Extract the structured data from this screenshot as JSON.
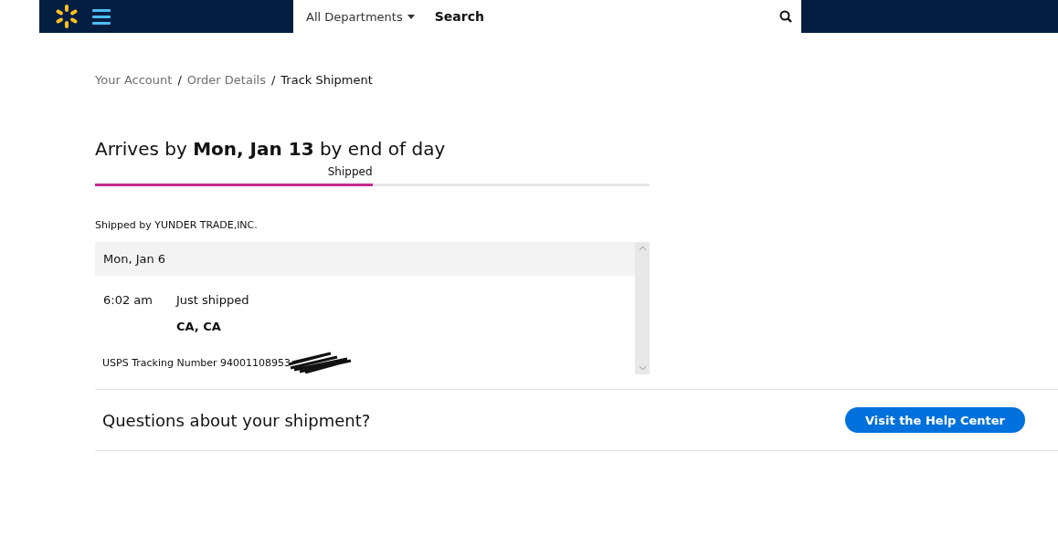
{
  "header": {
    "department_dropdown": "All Departments",
    "search": {
      "placeholder": "Search"
    }
  },
  "breadcrumb": [
    {
      "label": "Your Account",
      "current": false
    },
    {
      "label": "Order Details",
      "current": false
    },
    {
      "label": "Track Shipment",
      "current": true
    }
  ],
  "breadcrumb_separators": [
    "/",
    "/"
  ],
  "arrival": {
    "text": "Arrives by **Mon, Jan 13** by end of day"
  },
  "progress": {
    "label": "Shipped",
    "level": 0.5
  },
  "shipped_by": "Shipped by YUNDER TRADE,INC.",
  "tracking": {
    "date": "Mon, Jan 6",
    "events": [
      {
        "time": "6:02 am",
        "status": "Just shipped",
        "location": "CA, CA"
      }
    ],
    "number": "USPS Tracking Number 94001108953"
  },
  "help": {
    "question": "Questions about your shipment?",
    "button": "Visit the Help Center"
  }
}
